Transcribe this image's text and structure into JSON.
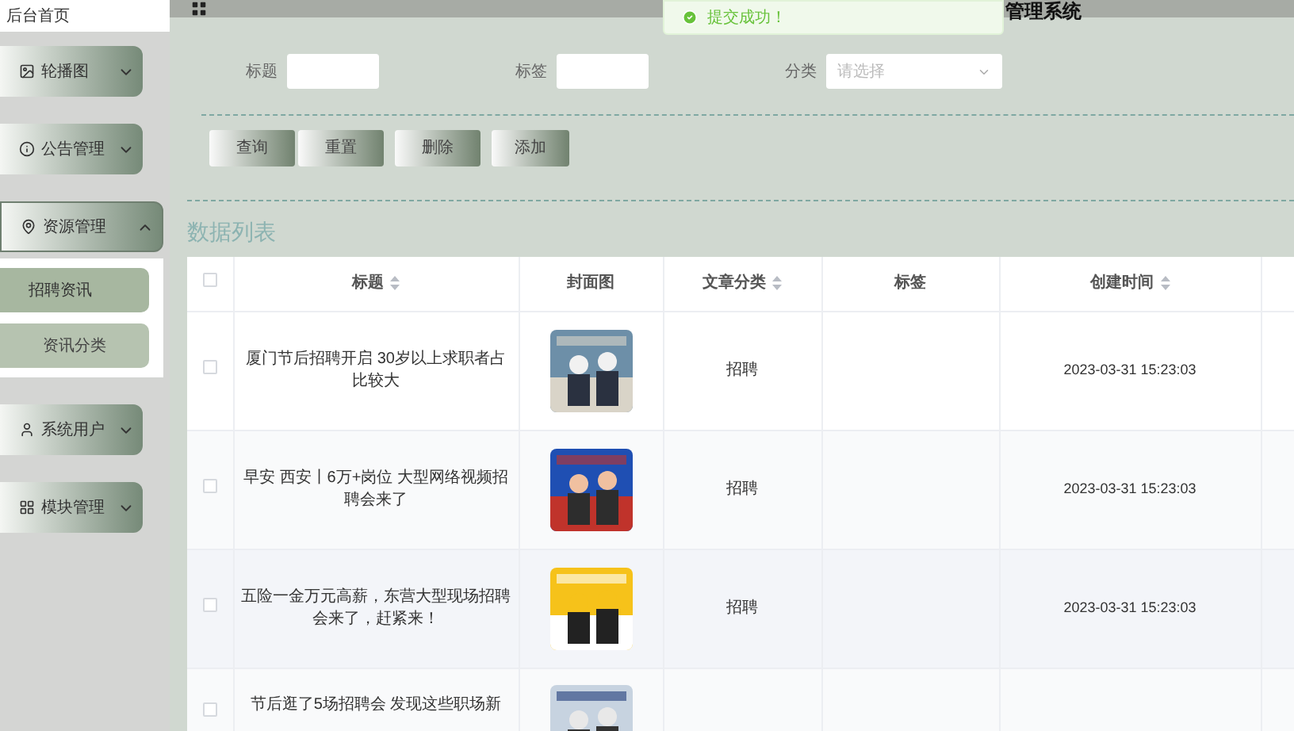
{
  "home_tab": {
    "label": "后台首页"
  },
  "header": {
    "title": "管理系统"
  },
  "toast": {
    "message": "提交成功！"
  },
  "sidebar": {
    "items": [
      {
        "label": "轮播图",
        "expanded": false
      },
      {
        "label": "公告管理",
        "expanded": false
      },
      {
        "label": "资源管理",
        "expanded": true,
        "children": [
          {
            "label": "招聘资讯",
            "selected": true
          },
          {
            "label": "资讯分类",
            "selected": false
          }
        ]
      },
      {
        "label": "系统用户",
        "expanded": false
      },
      {
        "label": "模块管理",
        "expanded": false
      }
    ]
  },
  "search": {
    "fields": [
      {
        "label": "标题",
        "kind": "text"
      },
      {
        "label": "标签",
        "kind": "text"
      },
      {
        "label": "分类",
        "kind": "select",
        "placeholder": "请选择"
      }
    ]
  },
  "actions": [
    "查询",
    "重置",
    "删除",
    "添加"
  ],
  "list_title": "数据列表",
  "table": {
    "select_all": {
      "checked": false
    },
    "columns": [
      {
        "label": "标题",
        "sortable": true
      },
      {
        "label": "封面图",
        "sortable": false
      },
      {
        "label": "文章分类",
        "sortable": true
      },
      {
        "label": "标签",
        "sortable": false
      },
      {
        "label": "创建时间",
        "sortable": true
      }
    ],
    "rows": [
      {
        "checked": false,
        "title": "厦门节后招聘开启 30岁以上求职者占比较大",
        "category": "招聘",
        "created": "2023-03-31 15:23:03"
      },
      {
        "checked": false,
        "title": "早安 西安丨6万+岗位 大型网络视频招聘会来了",
        "category": "招聘",
        "created": "2023-03-31 15:23:03"
      },
      {
        "checked": false,
        "title": "五险一金万元高薪，东营大型现场招聘会来了，赶紧来！",
        "category": "招聘",
        "created": "2023-03-31 15:23:03"
      },
      {
        "checked": false,
        "title": "节后逛了5场招聘会 发现这些职场新"
      }
    ]
  }
}
